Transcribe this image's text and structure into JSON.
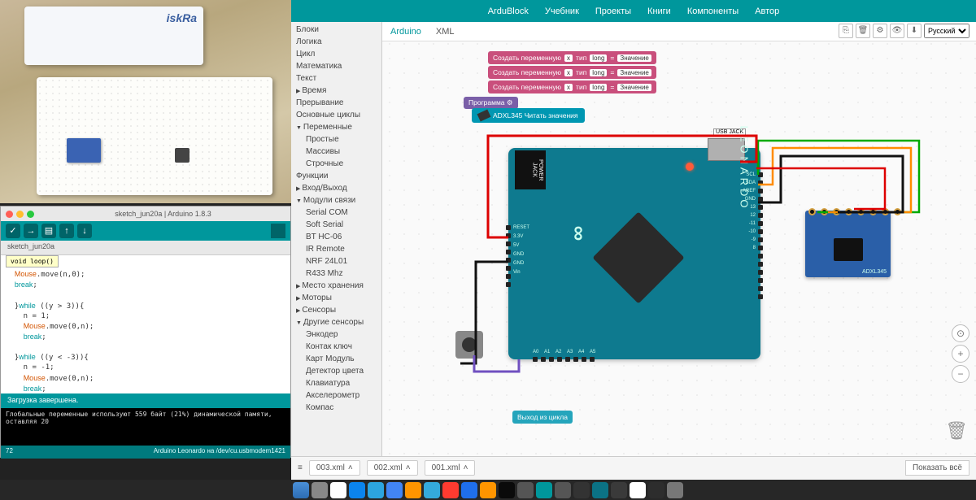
{
  "photo": {
    "board_label": "iskRa"
  },
  "ide": {
    "title": "sketch_jun20a | Arduino 1.8.3",
    "tab": "sketch_jun20a",
    "tooltip": "void loop()",
    "code": "void loop(){\n  Mouse.move(n,0);\n  break;\n\n  }while ((y > 3)){\n    n = 1;\n    Mouse.move(0,n);\n    break;\n\n  }while ((y < -3)){\n    n = -1;\n    Mouse.move(0,n);\n    break;\n  }\n\n}",
    "msgbar": "Загрузка завершена.",
    "console": "Глобальные переменные используют 559 байт (21%) динамической памяти, оставляя 20",
    "status_left": "72",
    "status_right": "Arduino Leonardo на /dev/cu.usbmodem1421"
  },
  "nav": [
    "ArduBlock",
    "Учебник",
    "Проекты",
    "Книги",
    "Компоненты",
    "Автор"
  ],
  "sidebar": [
    {
      "l": "Блоки",
      "t": ""
    },
    {
      "l": "Логика",
      "t": ""
    },
    {
      "l": "Цикл",
      "t": ""
    },
    {
      "l": "Математика",
      "t": ""
    },
    {
      "l": "Текст",
      "t": ""
    },
    {
      "l": "Время",
      "t": "col"
    },
    {
      "l": "Прерывание",
      "t": ""
    },
    {
      "l": "Основные циклы",
      "t": ""
    },
    {
      "l": "Переменные",
      "t": "exp"
    },
    {
      "l": "Простые",
      "t": "sub"
    },
    {
      "l": "Массивы",
      "t": "sub"
    },
    {
      "l": "Строчные",
      "t": "sub"
    },
    {
      "l": "Функции",
      "t": ""
    },
    {
      "l": "Вход/Выход",
      "t": "col"
    },
    {
      "l": "Модули связи",
      "t": "exp"
    },
    {
      "l": "Serial COM",
      "t": "sub"
    },
    {
      "l": "Soft Serial",
      "t": "sub"
    },
    {
      "l": "BT HC-06",
      "t": "sub"
    },
    {
      "l": "IR Remote",
      "t": "sub"
    },
    {
      "l": "NRF 24L01",
      "t": "sub"
    },
    {
      "l": "R433 Mhz",
      "t": "sub"
    },
    {
      "l": "Место хранения",
      "t": "col"
    },
    {
      "l": "Моторы",
      "t": "col"
    },
    {
      "l": "Сенсоры",
      "t": "col"
    },
    {
      "l": "Другие сенсоры",
      "t": "exp"
    },
    {
      "l": "Энкодер",
      "t": "sub"
    },
    {
      "l": "Контак ключ",
      "t": "sub"
    },
    {
      "l": "Карт Модуль",
      "t": "sub"
    },
    {
      "l": "Детектор цвета",
      "t": "sub"
    },
    {
      "l": "Клавиатура",
      "t": "sub"
    },
    {
      "l": "Акселерометр",
      "t": "sub"
    },
    {
      "l": "Компас",
      "t": "sub"
    }
  ],
  "canvas_tabs": [
    "Arduino",
    "XML"
  ],
  "lang_options": [
    "Русский"
  ],
  "blocks": {
    "var1": "Создать переменную",
    "var_dd": "x",
    "type_dd": "long",
    "val": "Значение",
    "prog": "Программа ⚙",
    "adxl": "ADXL345 Читать значения",
    "exit": "Выход из цикла"
  },
  "arduino": {
    "usb_label": "USB\nJACK",
    "pwr_label": "POWER\nJACK",
    "name": "LEONARDO",
    "right_pins": [
      "SCL",
      "SDA",
      "AREF",
      "GND",
      "13",
      "12",
      "-11",
      "-10",
      "-9",
      "8"
    ],
    "left_pins": [
      "RESET",
      "3.3V",
      "5V",
      "GND",
      "GND",
      "Vin"
    ],
    "bottom_pins": [
      "A0",
      "A1",
      "A2",
      "A3",
      "A4",
      "A5"
    ]
  },
  "adxl_label": "ADXL345",
  "files": [
    "003.xml",
    "002.xml",
    "001.xml"
  ],
  "showall": "Показать всё"
}
